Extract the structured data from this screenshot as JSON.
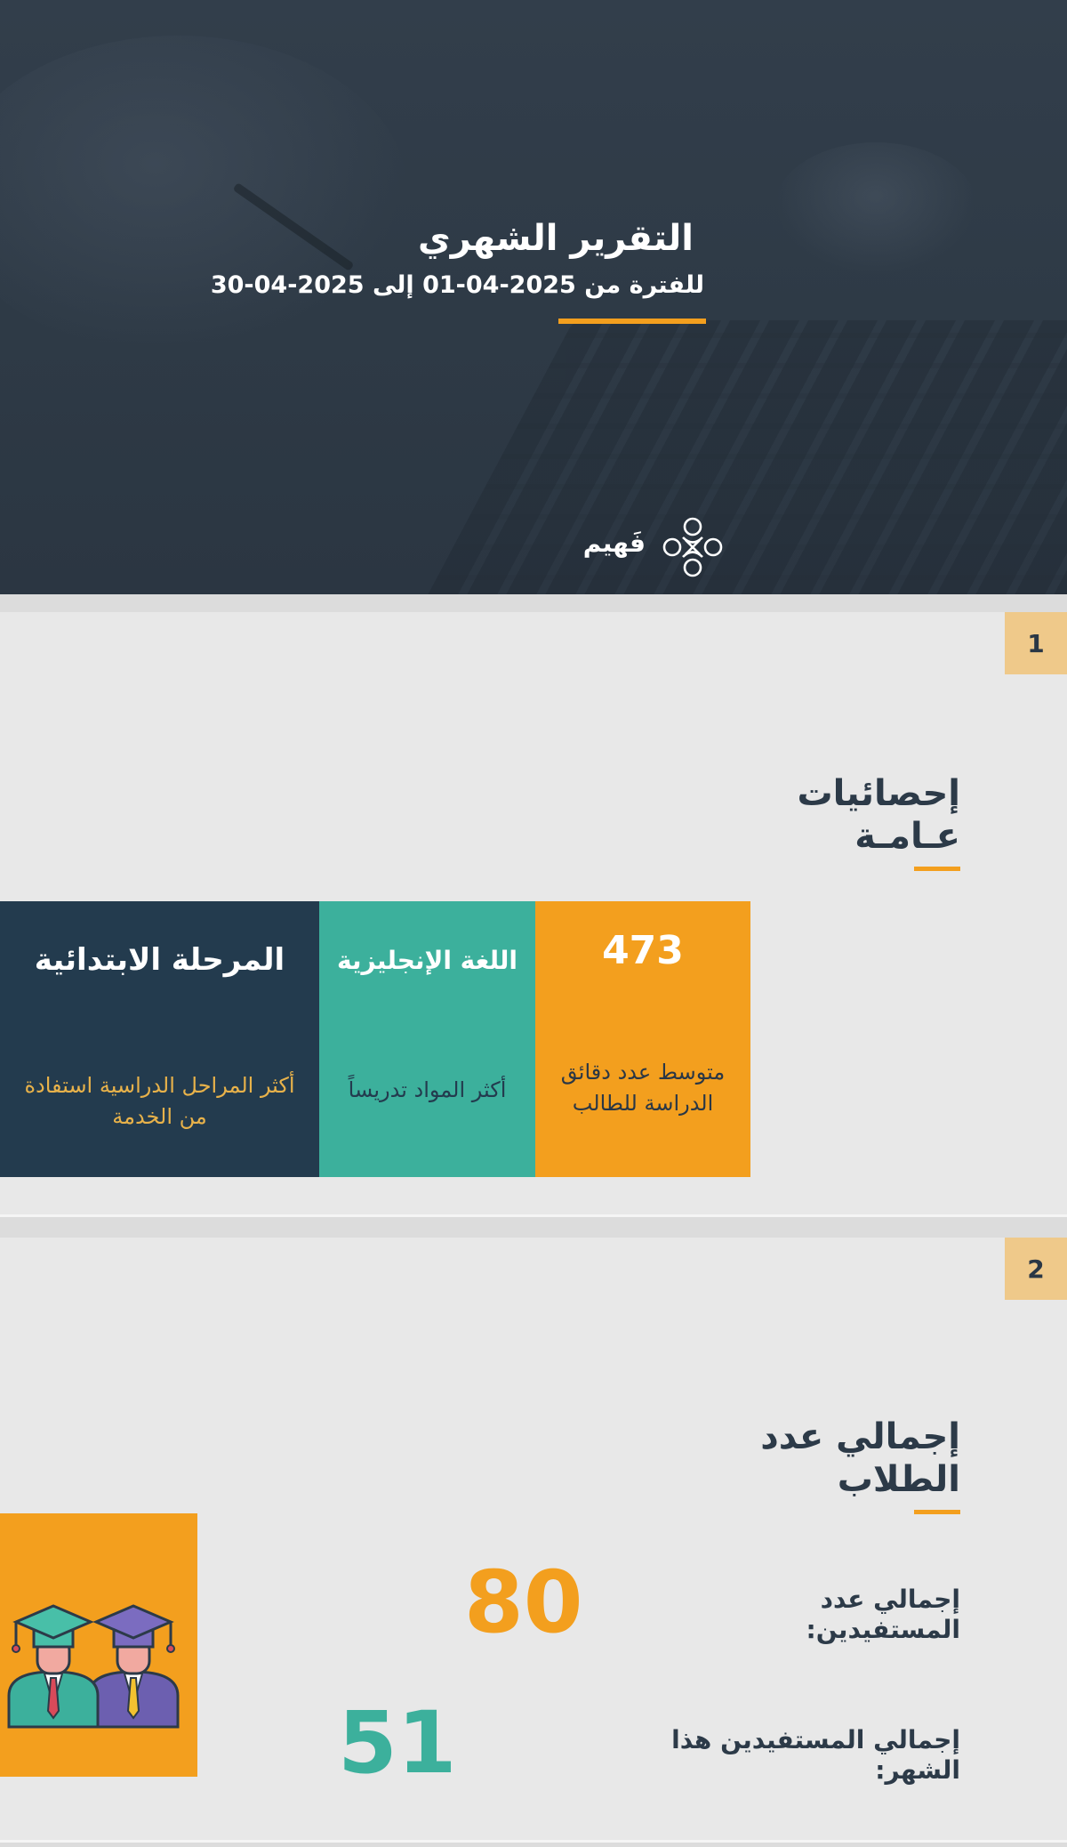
{
  "hero": {
    "title": "التقرير الشهري",
    "subtitle": "للفترة من 2025-04-01 إلى 2025-04-30",
    "logo_text": "فَهيم"
  },
  "slide1": {
    "number": "1",
    "title": "إحصائيات عـامـة",
    "stats": [
      {
        "value": "473",
        "description": "متوسط عدد دقائق الدراسة للطالب",
        "color": "#f39f1e"
      },
      {
        "value": "اللغة الإنجليزية",
        "description": "أكثر المواد تدريساً",
        "color": "#3cb09c"
      },
      {
        "value": "المرحلة الابتدائية",
        "description": "أكثر المراحل الدراسية استفادة من الخدمة",
        "color": "#233b4e"
      }
    ]
  },
  "slide2": {
    "number": "2",
    "title": "إجمالي عدد الطلاب",
    "metrics": [
      {
        "label": "إجمالي عدد المستفيدين:",
        "value": "80",
        "color": "#f39f1e"
      },
      {
        "label": "إجمالي المستفيدين هذا الشهر:",
        "value": "51",
        "color": "#3cb09c"
      }
    ],
    "illustration": "graduates-icon"
  },
  "colors": {
    "accent": "#f39f1e",
    "teal": "#3cb09c",
    "navy": "#233b4e",
    "number_badge": "#efc98a"
  }
}
